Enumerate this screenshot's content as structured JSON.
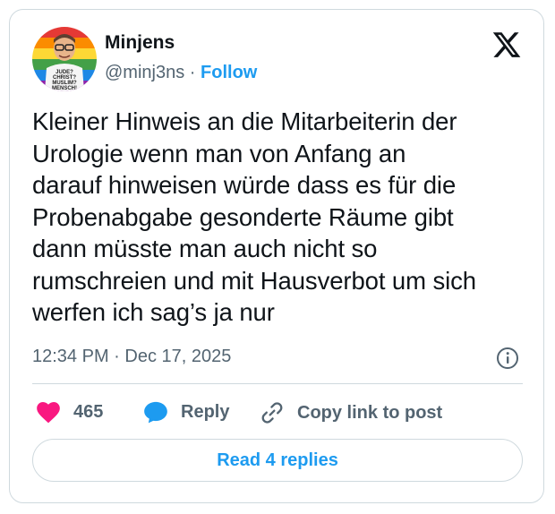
{
  "author": {
    "name": "Minjens",
    "handle": "@minj3ns",
    "separator": "·",
    "follow_label": "Follow",
    "avatar_shirt_text": [
      "JUDE?",
      "CHRIST?",
      "MUSLIM?",
      "MENSCH!"
    ]
  },
  "tweet": {
    "text": "Kleiner Hinweis an die Mitarbeiterin der\nUrologie wenn man von Anfang an\ndarauf hinweisen würde dass es für die\nProbenabgabe gesonderte Räume gibt\ndann müsste man auch nicht so\nrumschreien und mit Hausverbot um sich\nwerfen ich sag’s ja nur",
    "timestamp": "12:34 PM · Dec 17, 2025"
  },
  "actions": {
    "like_count": "465",
    "reply_label": "Reply",
    "copy_link_label": "Copy link to post"
  },
  "read_replies_label": "Read 4 replies",
  "colors": {
    "accent": "#1d9bf0",
    "heart": "#f91880",
    "muted": "#536471",
    "text": "#0f1419"
  },
  "icons": [
    "x-logo-icon",
    "info-icon",
    "heart-icon",
    "reply-bubble-icon",
    "link-icon"
  ]
}
